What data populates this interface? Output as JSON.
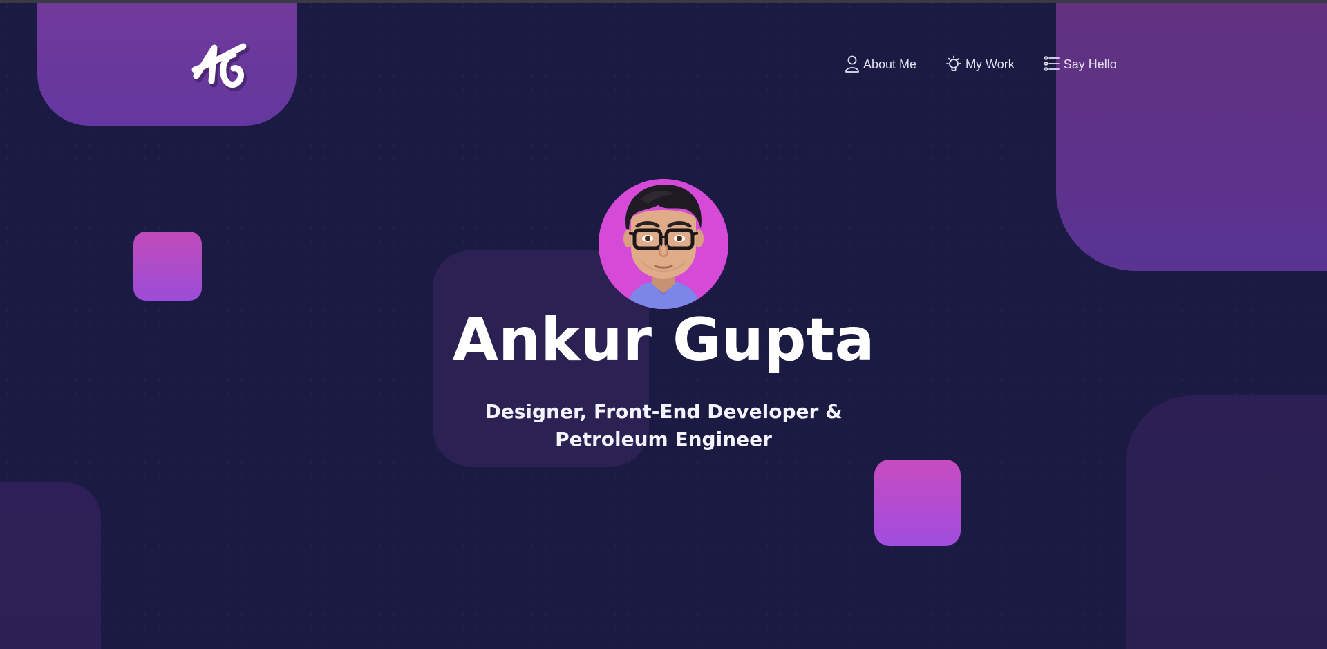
{
  "logo": {
    "text": "AG",
    "icon": "signature-logo-icon"
  },
  "nav": {
    "items": [
      {
        "label": "About Me",
        "icon": "user-icon"
      },
      {
        "label": "My Work",
        "icon": "lightbulb-icon"
      },
      {
        "label": "Say Hello",
        "icon": "list-icon"
      }
    ]
  },
  "hero": {
    "avatar": "avatar-memoji",
    "name": "Ankur Gupta",
    "subtitle_line1": "Designer, Front-End Developer &",
    "subtitle_line2": "Petroleum Engineer"
  },
  "colors": {
    "background": "#1a1a42",
    "accent_purple": "#6a38a0",
    "accent_pink": "#c84bc0",
    "text": "#ffffff"
  }
}
